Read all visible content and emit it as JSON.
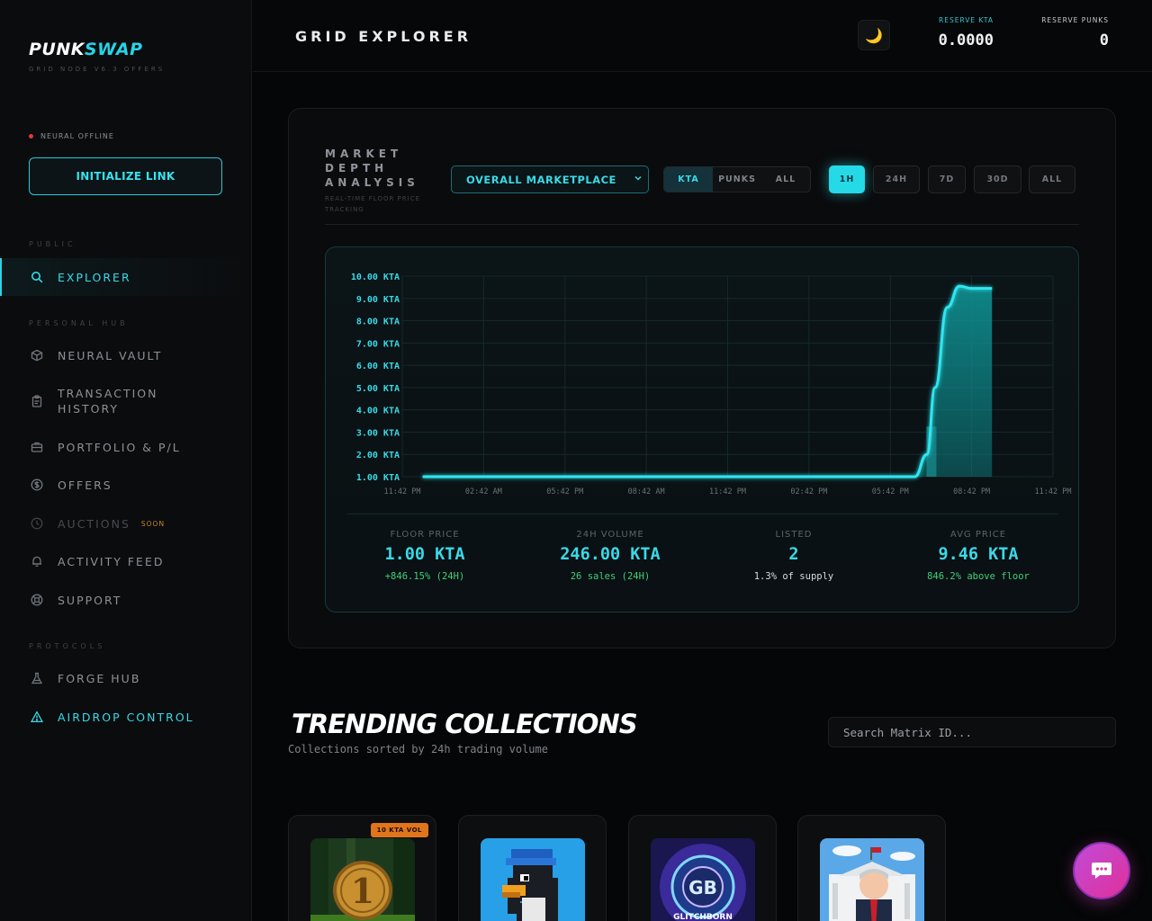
{
  "brand": {
    "logo_part1": "PUNK",
    "logo_part2": "SWAP",
    "subtitle": "GRID NODE V6.3 OFFERS"
  },
  "status": {
    "text": "NEURAL OFFLINE",
    "color": "#e0383c"
  },
  "init_button": "INITIALIZE LINK",
  "sidebar": {
    "sections": [
      "PUBLIC",
      "PERSONAL HUB",
      "PROTOCOLS"
    ],
    "items": [
      {
        "label": "EXPLORER",
        "icon": "search-icon"
      },
      {
        "label": "NEURAL VAULT",
        "icon": "cube-icon"
      },
      {
        "label": "TRANSACTION HISTORY",
        "icon": "clipboard-icon"
      },
      {
        "label": "PORTFOLIO & P/L",
        "icon": "briefcase-icon"
      },
      {
        "label": "OFFERS",
        "icon": "dollar-circle-icon"
      },
      {
        "label": "AUCTIONS",
        "icon": "clock-icon",
        "badge": "SOON"
      },
      {
        "label": "ACTIVITY FEED",
        "icon": "bell-icon"
      },
      {
        "label": "SUPPORT",
        "icon": "lifebuoy-icon"
      },
      {
        "label": "FORGE HUB",
        "icon": "flask-icon"
      },
      {
        "label": "AIRDROP CONTROL",
        "icon": "warning-triangle-icon"
      }
    ]
  },
  "header": {
    "title": "GRID EXPLORER",
    "theme_icon": "moon-icon",
    "reserve_kta_label": "RESERVE KTA",
    "reserve_kta_value": "0.0000",
    "reserve_punks_label": "RESERVE PUNKS",
    "reserve_punks_value": "0"
  },
  "market": {
    "title": "MARKET DEPTH ANALYSIS",
    "subtitle": "REAL-TIME FLOOR PRICE TRACKING",
    "marketplace_select": "OVERALL MARKETPLACE",
    "currency_tabs": [
      "KTA",
      "PUNKS",
      "ALL"
    ],
    "currency_active": "KTA",
    "time_tabs": [
      "1H",
      "24H",
      "7D",
      "30D",
      "ALL"
    ],
    "time_active": "1H"
  },
  "chart_data": {
    "type": "area",
    "title": "",
    "xlabel": "",
    "ylabel": "",
    "x_ticks": [
      "11:42 PM",
      "02:42 AM",
      "05:42 PM",
      "08:42 AM",
      "11:42 PM",
      "02:42 PM",
      "05:42 PM",
      "08:42 PM",
      "11:42 PM"
    ],
    "y_ticks": [
      "1.00 KTA",
      "2.00 KTA",
      "3.00 KTA",
      "4.00 KTA",
      "5.00 KTA",
      "6.00 KTA",
      "7.00 KTA",
      "8.00 KTA",
      "9.00 KTA",
      "10.00 KTA"
    ],
    "ylim": [
      1,
      10
    ],
    "x_range_index": [
      0,
      8
    ],
    "series": [
      {
        "values_x": [
          0.25,
          1,
          2,
          3,
          4,
          5,
          6,
          6.15,
          6.3,
          6.45,
          6.55,
          6.7,
          6.85,
          7.0,
          7.25
        ],
        "values_y": [
          1.0,
          1.0,
          1.0,
          1.0,
          1.0,
          1.0,
          1.0,
          1.0,
          1.0,
          2.0,
          5.0,
          8.6,
          9.55,
          9.45,
          9.45
        ]
      }
    ],
    "volume_bar": {
      "x": 6.5,
      "value": 3.25
    },
    "grid": true,
    "colors": {
      "line": "#2ee6f0",
      "fill": "#0e8a8c"
    }
  },
  "stats": [
    {
      "label": "FLOOR PRICE",
      "value": "1.00 KTA",
      "sub": "+846.15% (24H)",
      "sub_color": "#3fd07a"
    },
    {
      "label": "24H VOLUME",
      "value": "246.00 KTA",
      "sub": "26 sales (24H)",
      "sub_color": "#3fd07a"
    },
    {
      "label": "LISTED",
      "value": "2",
      "sub": "1.3% of supply",
      "sub_color": "#d7dde0"
    },
    {
      "label": "AVG PRICE",
      "value": "9.46 KTA",
      "sub": "846.2% above floor",
      "sub_color": "#3fd07a"
    }
  ],
  "trending": {
    "title": "TRENDING COLLECTIONS",
    "subtitle": "Collections sorted by 24h trading volume",
    "search_placeholder": "Search Matrix ID...",
    "cards": [
      {
        "badge": "10 KTA VOL",
        "image": "gold-coin-image"
      },
      {
        "image": "pixel-penguin-image"
      },
      {
        "image": "glitchborn-logo-image",
        "image_text": "GLITCHBORN"
      },
      {
        "image": "white-house-caricature-image"
      }
    ]
  },
  "chat_icon": "chat-bubble-icon",
  "colors": {
    "accent": "#26d9e6",
    "bg": "#050607",
    "warning": "#e0751c",
    "positive": "#3fd07a"
  }
}
